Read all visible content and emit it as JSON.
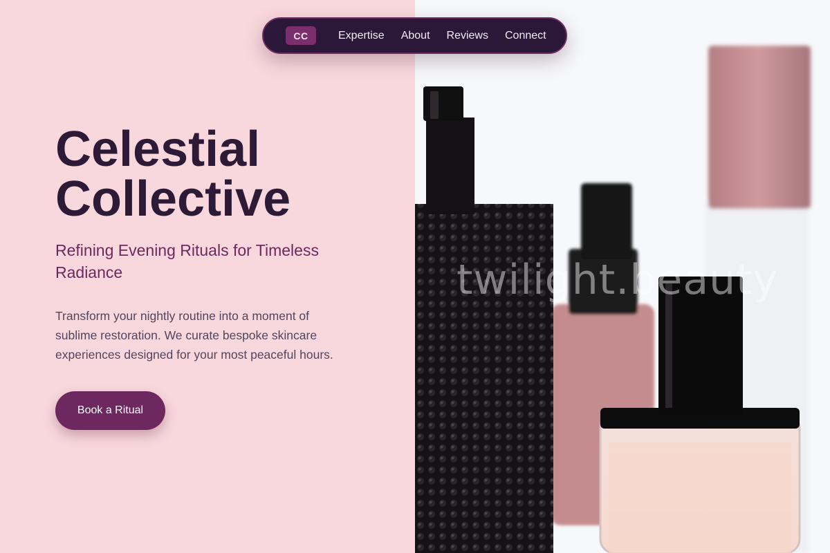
{
  "nav": {
    "logo": "CC",
    "links": [
      "Expertise",
      "About",
      "Reviews",
      "Connect"
    ]
  },
  "hero": {
    "title_line1": "Celestial",
    "title_line2": "Collective",
    "subtitle": "Refining Evening Rituals for Timeless Radiance",
    "body": "Transform your nightly routine into a moment of sublime restoration. We curate bespoke skincare experiences designed for your most peaceful hours.",
    "cta_label": "Book a Ritual"
  },
  "image": {
    "watermark": "twilight.beauty",
    "subject": "perfume-bottles-photo"
  },
  "colors": {
    "background_pink": "#f9d8dd",
    "nav_dark": "#2b1838",
    "accent_plum": "#6d285f",
    "title_dark": "#2d1a36"
  }
}
